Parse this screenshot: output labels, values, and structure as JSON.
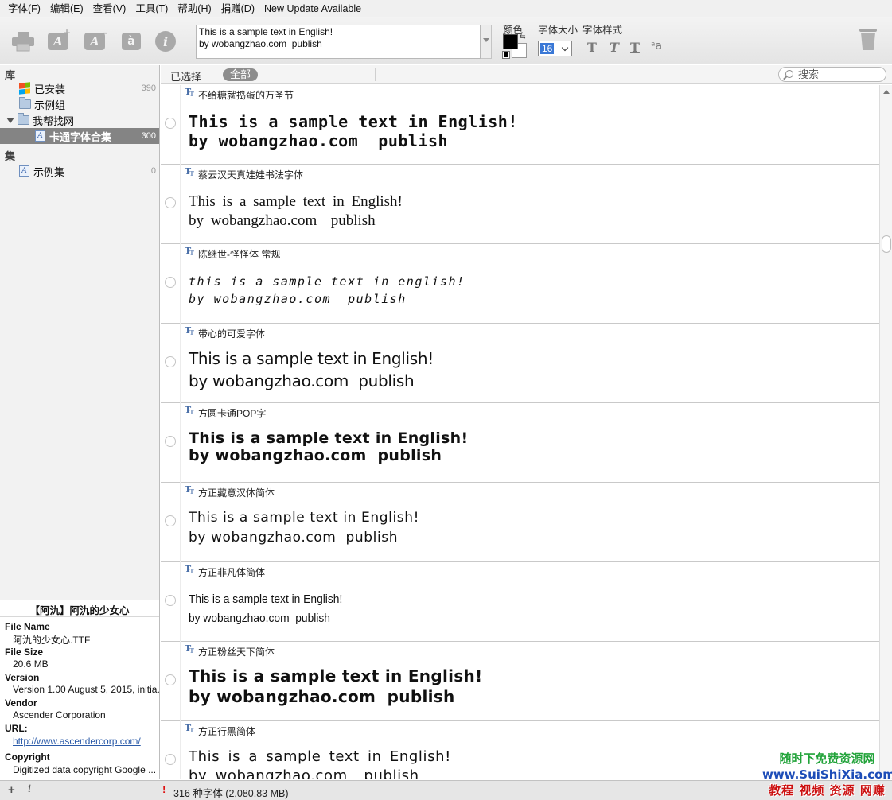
{
  "menu": {
    "items": [
      "字体(F)",
      "编辑(E)",
      "查看(V)",
      "工具(T)",
      "帮助(H)",
      "捐赠(D)"
    ],
    "update_notice": "New Update Available"
  },
  "toolbar": {
    "icons": [
      "print-icon",
      "add-font-icon",
      "remove-font-icon",
      "activate-font-icon",
      "info-icon",
      "trash-icon"
    ],
    "activate_glyph": "à",
    "add_glyph": "A",
    "remove_glyph": "A",
    "info_glyph": "i",
    "preview_text": "This is a sample text in English!\nby wobangzhao.com  publish",
    "color_label": "颜色",
    "size_label": "字体大小",
    "style_label": "字体样式",
    "font_size": "16",
    "style_buttons": [
      "T",
      "T",
      "T",
      "ᵃa"
    ],
    "color_fg": "#000000",
    "color_bg": "#ffffff"
  },
  "sidebar": {
    "library_title": "库",
    "items": [
      {
        "label": "已安装",
        "count": "390"
      },
      {
        "label": "示例组",
        "count": ""
      },
      {
        "label": "我帮找网",
        "count": ""
      },
      {
        "label": "卡通字体合集",
        "count": "300"
      }
    ],
    "sets_title": "集",
    "sets": [
      {
        "label": "示例集",
        "count": "0"
      }
    ]
  },
  "info": {
    "title": "【阿氿】阿氿的少女心",
    "file_name_label": "File Name",
    "file_name": "阿氿的少女心.TTF",
    "file_size_label": "File Size",
    "file_size": "20.6 MB",
    "version_label": "Version",
    "version": "Version 1.00 August 5, 2015, initia...",
    "vendor_label": "Vendor",
    "vendor": "Ascender Corporation",
    "url_label": "URL:",
    "url": "http://www.ascendercorp.com/",
    "copyright_label": "Copyright",
    "copyright": "Digitized data copyright Google ..."
  },
  "filter": {
    "selected_label": "已选择",
    "all_label": "全部",
    "search_placeholder": "搜索"
  },
  "fonts": [
    {
      "name": "不给糖就捣蛋的万圣节",
      "line1": "This is a sample text in English!",
      "line2": "by wobangzhao.com  publish"
    },
    {
      "name": "蔡云汉天真娃娃书法字体",
      "line1": "This is a sample text in English!",
      "line2": "by wobangzhao.com  publish"
    },
    {
      "name": "陈继世-怪怪体 常规",
      "line1": "this is a sample text in english!",
      "line2": "by wobangzhao.com  publish"
    },
    {
      "name": "带心的可爱字体",
      "line1": "This is a sample text in English!",
      "line2": "by wobangzhao.com  publish"
    },
    {
      "name": "方圆卡通POP字",
      "line1": "This is a sample text in English!",
      "line2": "by wobangzhao.com  publish"
    },
    {
      "name": "方正藏意汉体简体",
      "line1": "This is a sample text in English!",
      "line2": "by wobangzhao.com  publish"
    },
    {
      "name": "方正非凡体简体",
      "line1": "This is a sample text in English!",
      "line2": "by wobangzhao.com  publish"
    },
    {
      "name": "方正粉丝天下简体",
      "line1": "This is a sample text in English!",
      "line2": "by wobangzhao.com  publish"
    },
    {
      "name": "方正行黑简体",
      "line1": "This is a sample text in English!",
      "line2": "by wobangzhao.com  publish"
    }
  ],
  "status": {
    "warning": "!",
    "summary": "316 种字体 (2,080.83 MB)",
    "add_button": "+",
    "info_button": "i"
  },
  "watermark": {
    "line1": "随时下免费资源网",
    "line2": "www.SuiShiXia.com",
    "line3": "教程 视频 资源 网赚"
  }
}
